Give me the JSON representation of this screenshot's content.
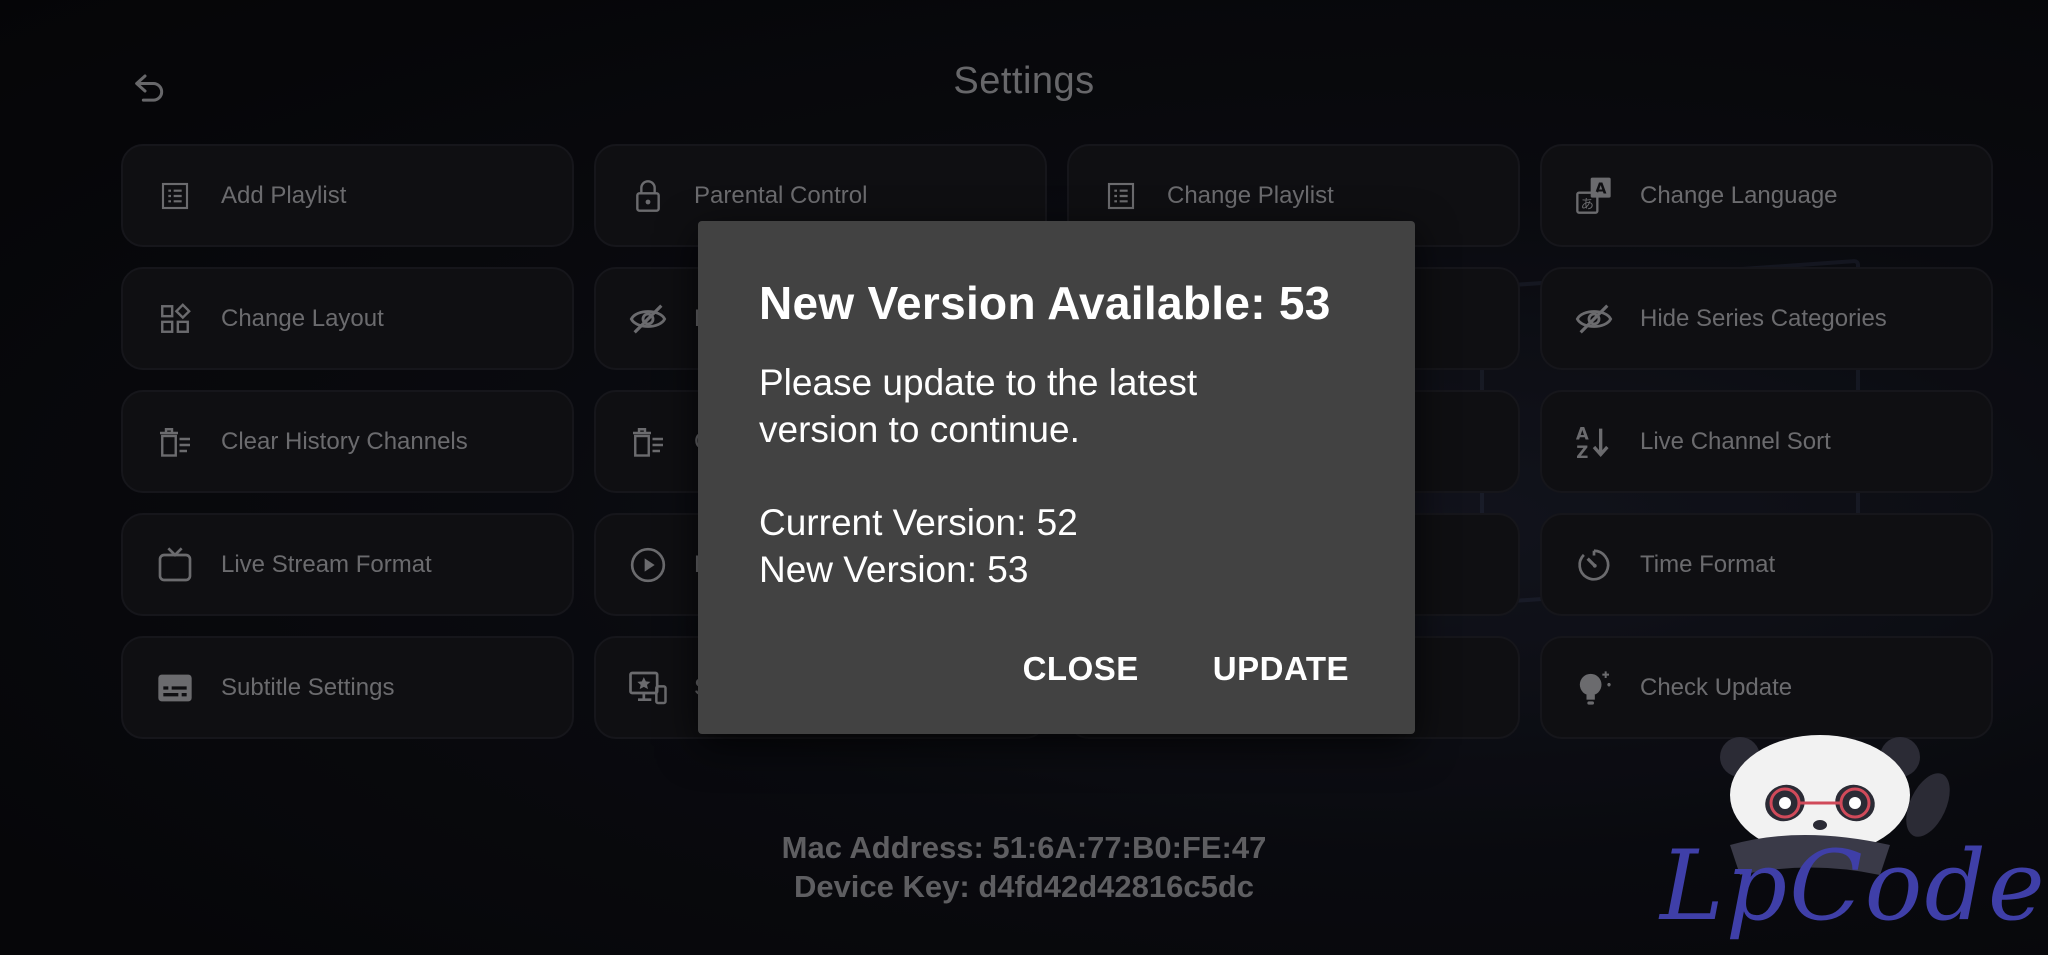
{
  "header": {
    "title": "Settings"
  },
  "tiles": [
    {
      "label": "Add Playlist",
      "icon": "list-icon"
    },
    {
      "label": "Parental Control",
      "icon": "lock-icon"
    },
    {
      "label": "Change Playlist",
      "icon": "list-icon"
    },
    {
      "label": "Change Language",
      "icon": "translate-icon"
    },
    {
      "label": "Change Layout",
      "icon": "layout-icon"
    },
    {
      "label": "H",
      "icon": "eye-off-icon"
    },
    {
      "label": "",
      "icon": ""
    },
    {
      "label": "Hide Series Categories",
      "icon": "eye-off-icon"
    },
    {
      "label": "Clear History Channels",
      "icon": "trash-list-icon"
    },
    {
      "label": "C",
      "icon": "trash-list-icon"
    },
    {
      "label": "",
      "icon": ""
    },
    {
      "label": "Live Channel Sort",
      "icon": "sort-az-icon"
    },
    {
      "label": "Live Stream Format",
      "icon": "tv-icon"
    },
    {
      "label": "E",
      "icon": "play-circle-icon"
    },
    {
      "label": "",
      "icon": ""
    },
    {
      "label": "Time Format",
      "icon": "timer-icon"
    },
    {
      "label": "Subtitle Settings",
      "icon": "subtitles-icon"
    },
    {
      "label": "S",
      "icon": "display-star-icon"
    },
    {
      "label": "",
      "icon": ""
    },
    {
      "label": "Check Update",
      "icon": "lightbulb-icon"
    }
  ],
  "device": {
    "mac": "Mac Address: 51:6A:77:B0:FE:47",
    "key": "Device Key: d4fd42d42816c5dc"
  },
  "dialog": {
    "title": "New Version Available: 53",
    "message": "Please update to the latest version to continue.",
    "current": "Current Version: 52",
    "new": "New Version: 53",
    "close_label": "CLOSE",
    "update_label": "UPDATE"
  },
  "watermark": {
    "text": "LpCodes"
  },
  "colors": {
    "dialog_bg": "#424242",
    "tile_bg": "#141418",
    "watermark": "#3f3fa8"
  }
}
